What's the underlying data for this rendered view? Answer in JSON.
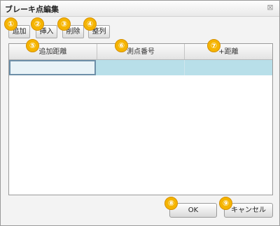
{
  "dialog": {
    "title": "ブレーキ点編集",
    "close_icon": "⊠"
  },
  "toolbar": {
    "add_label": "追加",
    "insert_label": "挿入",
    "delete_label": "削除",
    "sort_label": "整列"
  },
  "grid": {
    "columns": [
      "追加距離",
      "測点番号",
      "+距離"
    ],
    "rows": [
      [
        "",
        "",
        ""
      ]
    ]
  },
  "actions": {
    "ok_label": "OK",
    "cancel_label": "キャンセル"
  },
  "markers": [
    "①",
    "②",
    "③",
    "④",
    "⑤",
    "⑥",
    "⑦",
    "⑧",
    "⑨"
  ],
  "colors": {
    "marker": "#f5b400",
    "selected_row": "#b8dfe9"
  }
}
